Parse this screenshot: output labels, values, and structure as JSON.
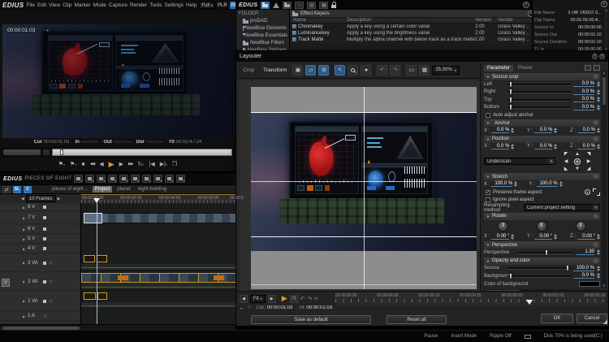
{
  "menubar": {
    "logo": "EDIUS",
    "items": [
      "File",
      "Edit",
      "View",
      "Clip",
      "Marker",
      "Mode",
      "Capture",
      "Render",
      "Tools",
      "Settings",
      "Help"
    ],
    "layout_mode": "Full",
    "plr": "PLR",
    "rec": "REC"
  },
  "preview": {
    "timecode": "00:00:01:03",
    "info": {
      "cur_label": "Cur",
      "cur": "00:00:01:03",
      "in_label": "In",
      "in": "--:--:--:--",
      "out_label": "Out",
      "out": "--:--:--:--",
      "dur_label": "Dur",
      "dur": "--:--:--:--",
      "ttl_label": "Ttl",
      "ttl": "00:02:47:24"
    }
  },
  "effect_palette": {
    "logo": "EDIUS",
    "folder_header": "FOLDER",
    "tree": [
      "proDAD",
      "NewBlue Elements",
      "NewBlue Essentials",
      "NewBlue Filters",
      "NewBlue Stylizers"
    ],
    "list_title": "Effect Keyers",
    "columns": {
      "name": "Name",
      "description": "Description",
      "version": "Version",
      "vendor": "Vendor"
    },
    "rows": [
      {
        "name": "Chromakey",
        "description": "Apply a key using a certain color value",
        "version": "2.00",
        "vendor": "Grass Valley .."
      },
      {
        "name": "Luminancekey",
        "description": "Apply a key using the brightness value",
        "version": "2.00",
        "vendor": "Grass Valley .."
      },
      {
        "name": "Track Matte",
        "description": "Multiply the alpha channel with below track as a track matte",
        "version": "1.00",
        "vendor": "Grass Valley .."
      }
    ]
  },
  "clip_info": {
    "rows": [
      {
        "label": "File Name",
        "value": "2 (4K VIDEO S..."
      },
      {
        "label": "Clip Name",
        "value": "00.00.00.00 A..."
      },
      {
        "label": "Source In",
        "value": "00:00:00:00"
      },
      {
        "label": "Source Out",
        "value": "00:00:01:10"
      },
      {
        "label": "Source Duration",
        "value": "00:00:01:10"
      },
      {
        "label": "TL In",
        "value": "00:00:00:00"
      }
    ]
  },
  "layouter": {
    "title": "Layouter",
    "tab_crop": "Crop",
    "tab_transform": "Transform",
    "zoom_level": "25.00%",
    "param_tab": "Parameter",
    "preset_tab": "Preset",
    "source_crop": {
      "title": "Source crop",
      "left_label": "Left",
      "left": "0.0 %",
      "right_label": "Right",
      "right": "0.0 %",
      "top_label": "Top",
      "top": "0.0 %",
      "bottom_label": "Bottom",
      "bottom": "0.0 %",
      "auto_adjust": "Auto adjust anchor"
    },
    "anchor": {
      "title": "Anchor",
      "x_label": "X :",
      "x": "0.0 %",
      "y_label": "Y :",
      "y": "0.0 %",
      "z_label": "Z :",
      "z": "0.0 %"
    },
    "position": {
      "title": "Position",
      "x_label": "X :",
      "x": "0.0 %",
      "y_label": "Y :",
      "y": "0.0 %",
      "z_label": "Z :",
      "z": "0.0 %",
      "underscan": "Underscan"
    },
    "stretch": {
      "title": "Stretch",
      "x_label": "X :",
      "x": "100.0 %",
      "y_label": "Y :",
      "y": "100.0 %",
      "preserve": "Preserve frame aspect",
      "ignore": "Ignore pixel aspect",
      "resampling_label": "Resampling method",
      "resampling": "Current project setting"
    },
    "rotate": {
      "title": "Rotate",
      "x_label": "X :",
      "x": "0.00 °",
      "y_label": "Y :",
      "y": "0.00 °",
      "z_label": "Z :",
      "z": "0.00 °"
    },
    "perspective": {
      "title": "Perspective",
      "label": "Perspective",
      "value": "1.30"
    },
    "opacity": {
      "title": "Opacity and color",
      "source_label": "Source",
      "source": "100.0 %",
      "background_label": "Background",
      "background": "0.0 %",
      "color_label": "Color of background"
    },
    "transport_fit": "Fit",
    "ruler": [
      "00:00:00:00",
      "00:00:00:05",
      "00:00:00:10",
      "00:00:00:15",
      "00:00:00:20",
      "00:00:01:01",
      "00:00:01:06"
    ],
    "cur_label": "Cur:",
    "cur": "00:00:01:03",
    "ttl_label": "Ttl:",
    "ttl": "00:00:01:03",
    "save_default": "Save as default",
    "reset_all": "Reset all",
    "ok": "OK",
    "cancel": "Cancel"
  },
  "timeline": {
    "logo": "EDIUS",
    "sequence_title": "PIECES OF EIGHT",
    "tabs": [
      "pieces of eight...",
      "Project",
      "planet",
      "eight building"
    ],
    "scale_value": "10 Frames",
    "ruler": [
      "00:00:00:00",
      "00:00:02:00",
      "00:00:04:00",
      "00:00:06:00",
      "00:00:0"
    ],
    "tracks": [
      {
        "label": "8 V"
      },
      {
        "label": "7 V"
      },
      {
        "label": "6 V"
      },
      {
        "label": "5 V"
      },
      {
        "label": "4 V"
      },
      {
        "label": "3 VA"
      },
      {
        "label": "2 VA"
      },
      {
        "label": "1 VA"
      },
      {
        "label": "1 A"
      }
    ],
    "patch_label": "V",
    "mode_sl": "SL",
    "mode_c": "C"
  },
  "statusbar": {
    "pause": "Pause",
    "insert_mode": "Insert Mode",
    "ripple": "Ripple Off",
    "disk": "Disk  70% is being used(C:)"
  }
}
